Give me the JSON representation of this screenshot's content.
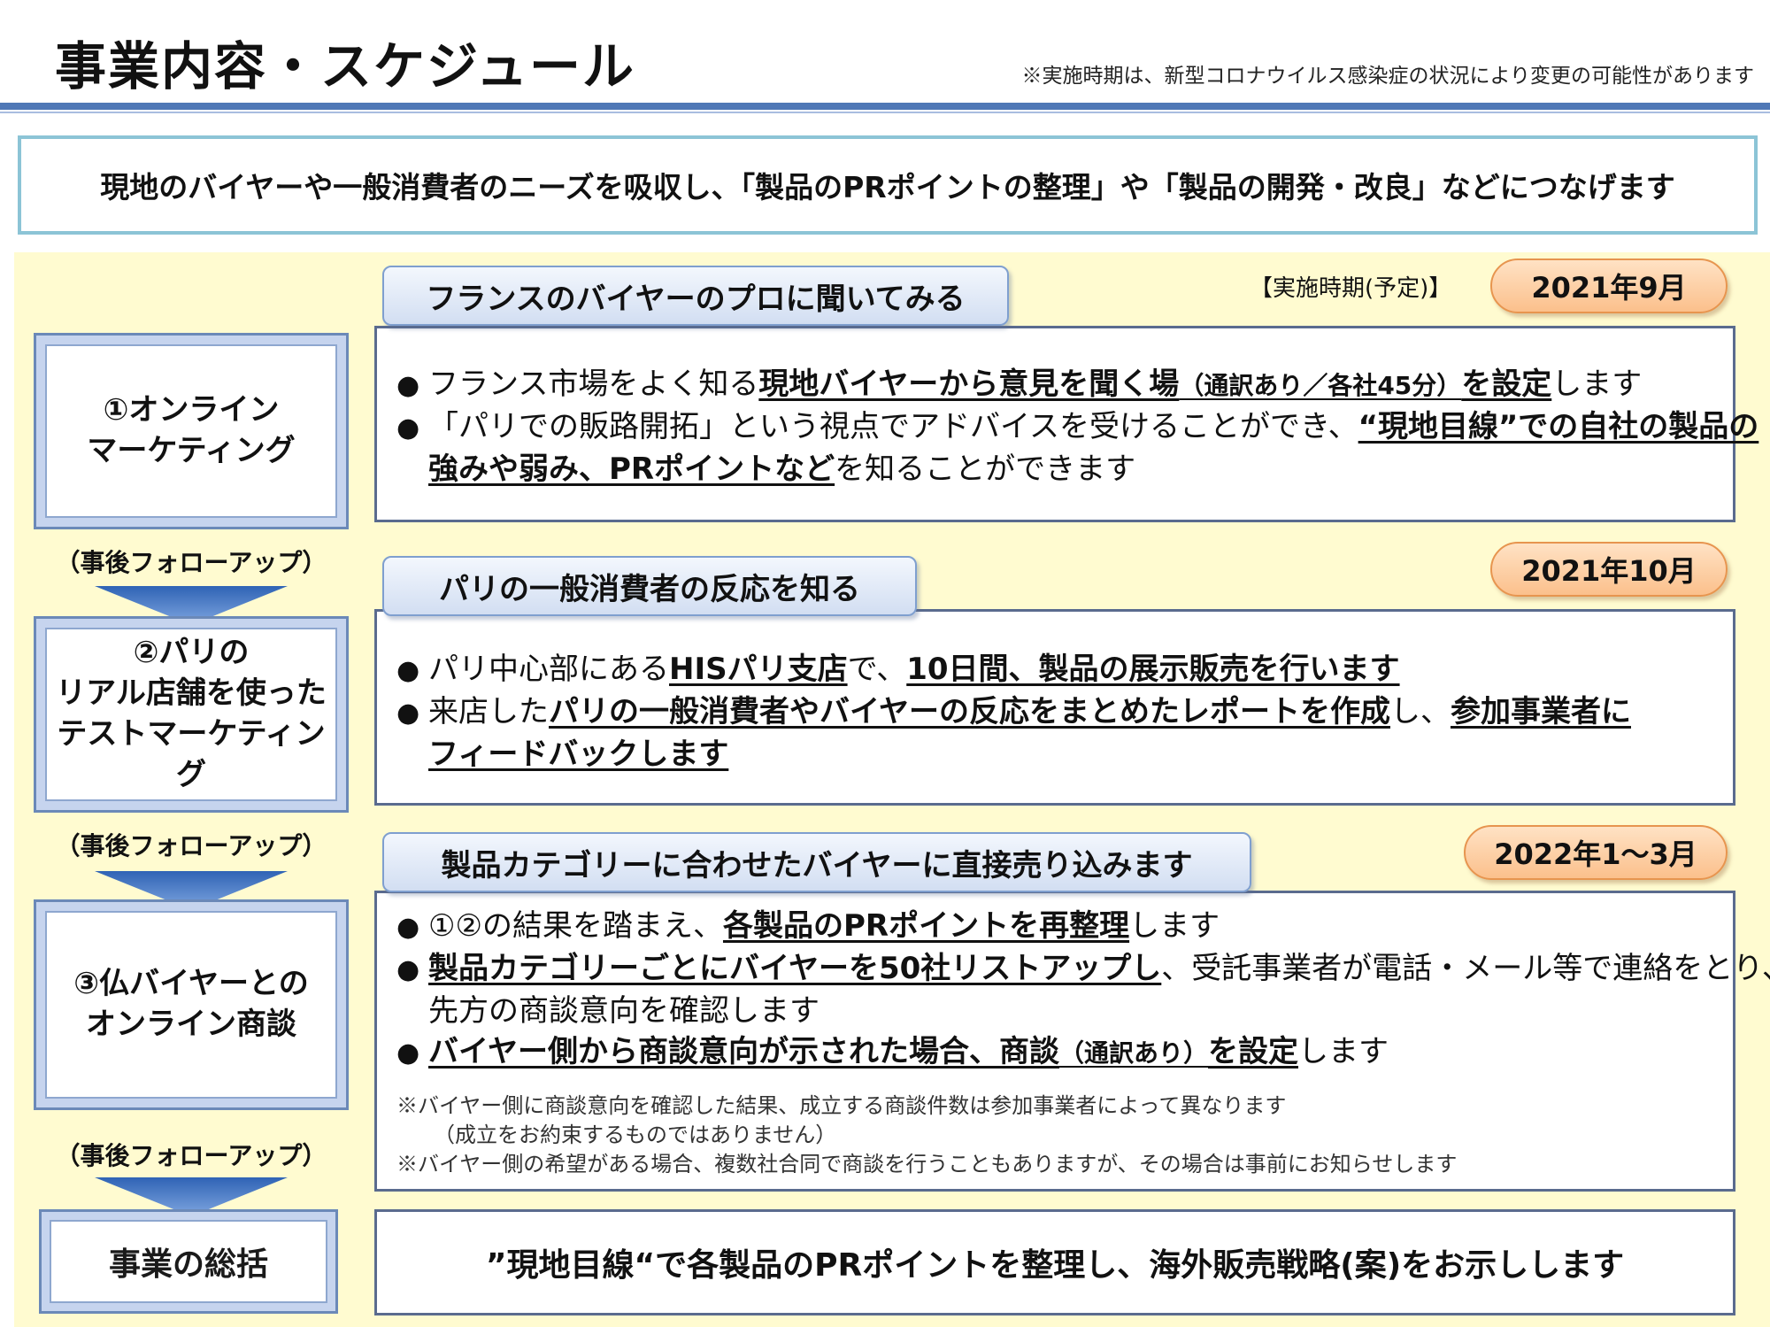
{
  "header": {
    "title": "事業内容・スケジュール",
    "note": "※実施時期は、新型コロナウイルス感染症の状況により変更の可能性があります"
  },
  "banner": "現地のバイヤーや一般消費者のニーズを吸収し、「製品のPRポイントの整理」や「製品の開発・改良」などにつなげます",
  "period_label": "【実施時期(予定)】",
  "followup_label": "（事後フォローアップ）",
  "steps": [
    {
      "label": "①オンライン\nマーケティング",
      "tag": "フランスのバイヤーのプロに聞いてみる",
      "date": "2021年9月",
      "l1_a": "フランス市場をよく知る",
      "l1_b": "現地バイヤーから意見を聞く場",
      "l1_c": "（通訳あり／各社45分）",
      "l1_d": "を設定",
      "l1_e": "します",
      "l2_a": "「パリでの販路開拓」という視点でアドバイスを受けることができ、",
      "l2_b": "“現地目線”での自社の製品の",
      "l3_a": "強みや弱み、PRポイントなど",
      "l3_b": "を知ることができます"
    },
    {
      "label": "②パリの\nリアル店舗を使った\nテストマーケティング",
      "tag": "パリの一般消費者の反応を知る",
      "date": "2021年10月",
      "l1_a": "パリ中心部にある",
      "l1_b": "HISパリ支店",
      "l1_c": "で、",
      "l1_d": "10日間、製品の展示販売を行います",
      "l2_a": "来店した",
      "l2_b": "パリの一般消費者やバイヤーの反応をまとめたレポートを作成",
      "l2_c": "し、",
      "l2_d": "参加事業者に",
      "l3_a": "フィードバックします"
    },
    {
      "label": "③仏バイヤーとの\nオンライン商談",
      "tag": "製品カテゴリーに合わせたバイヤーに直接売り込みます",
      "date": "2022年1～3月",
      "l1_a": "①②の結果を踏まえ、",
      "l1_b": "各製品のPRポイントを再整理",
      "l1_c": "します",
      "l2_a": "製品カテゴリーごとにバイヤーを50社リストアップし",
      "l2_b": "、受託事業者が電話・メール等で連絡をとり、",
      "l3_a": "先方の商談意向を確認します",
      "l4_a": "バイヤー側から商談意向が示された場合、商談",
      "l4_b": "（通訳あり）",
      "l4_c": "を設定",
      "l4_d": "します",
      "note1": "※バイヤー側に商談意向を確認した結果、成立する商談件数は参加事業者によって異なります",
      "note2": "（成立をお約束するものではありません）",
      "note3": "※バイヤー側の希望がある場合、複数社合同で商談を行うこともありますが、その場合は事前にお知らせします"
    }
  ],
  "summary": {
    "label": "事業の総括",
    "text": "”現地目線“で各製品のPRポイントを整理し、海外販売戦略(案)をお示しします"
  },
  "colors": {
    "accent_rule": "#4f78b6",
    "panel_bg": "#fffbd0",
    "step_frame": "#c6d4ee",
    "date_pill": "#fbc08c"
  }
}
